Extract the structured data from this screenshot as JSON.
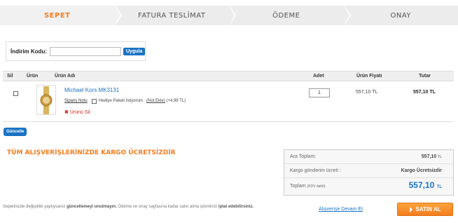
{
  "steps": [
    {
      "label": "SEPET"
    },
    {
      "label": "FATURA TESLİMAT"
    },
    {
      "label": "ÖDEME"
    },
    {
      "label": "ONAY"
    }
  ],
  "discount": {
    "label": "İndirim Kodu:",
    "value": "",
    "apply_label": "Uygula"
  },
  "table": {
    "headers": {
      "remove": "Sil",
      "image": "Ürün",
      "name": "Ürün Adı",
      "qty": "Adet",
      "price": "Ürün Fiyatı",
      "total": "Tutar"
    },
    "items": [
      {
        "name": "Michael Kors MK3131",
        "order_note": "Sipariş Notu",
        "gift_label": "Hediye Paketi İstiyorum",
        "gift_status": "(Not Ekle)",
        "gift_price": "(+4,99 TL)",
        "remove_label": "Ürünü Sil",
        "qty": "1",
        "unit_price": "557,10 TL",
        "total": "557,10 TL"
      }
    ],
    "update_label": "Güncelle"
  },
  "promo": "TÜM ALIŞVERİŞLERİNİZDE KARGO ÜCRETSİZDİR",
  "summary": {
    "subtotal_label": "Ara Toplam:",
    "subtotal_value": "557,10",
    "subtotal_cur": "TL",
    "shipping_label": "Kargo gönderim ücreti :",
    "shipping_value": "Kargo Ücretsizdir",
    "total_label": "Toplam",
    "total_note": "(KDV dahil):",
    "total_value": "557,10",
    "total_cur": "TL"
  },
  "footer": {
    "note_1": "Sepetinizde değişiklik yaptıysanız ",
    "note_bold_1": "güncellemeyi unutmayın.",
    "note_2": " Ödeme ve onay sayfasına kadar satın alma işleminizi ",
    "note_bold_2": "iptal edebilirsiniz.",
    "continue_label": "Alışverişe Devam Et",
    "buy_label": "SATIN AL"
  },
  "colors": {
    "accent": "#f47d20",
    "link": "#1a73c4"
  }
}
